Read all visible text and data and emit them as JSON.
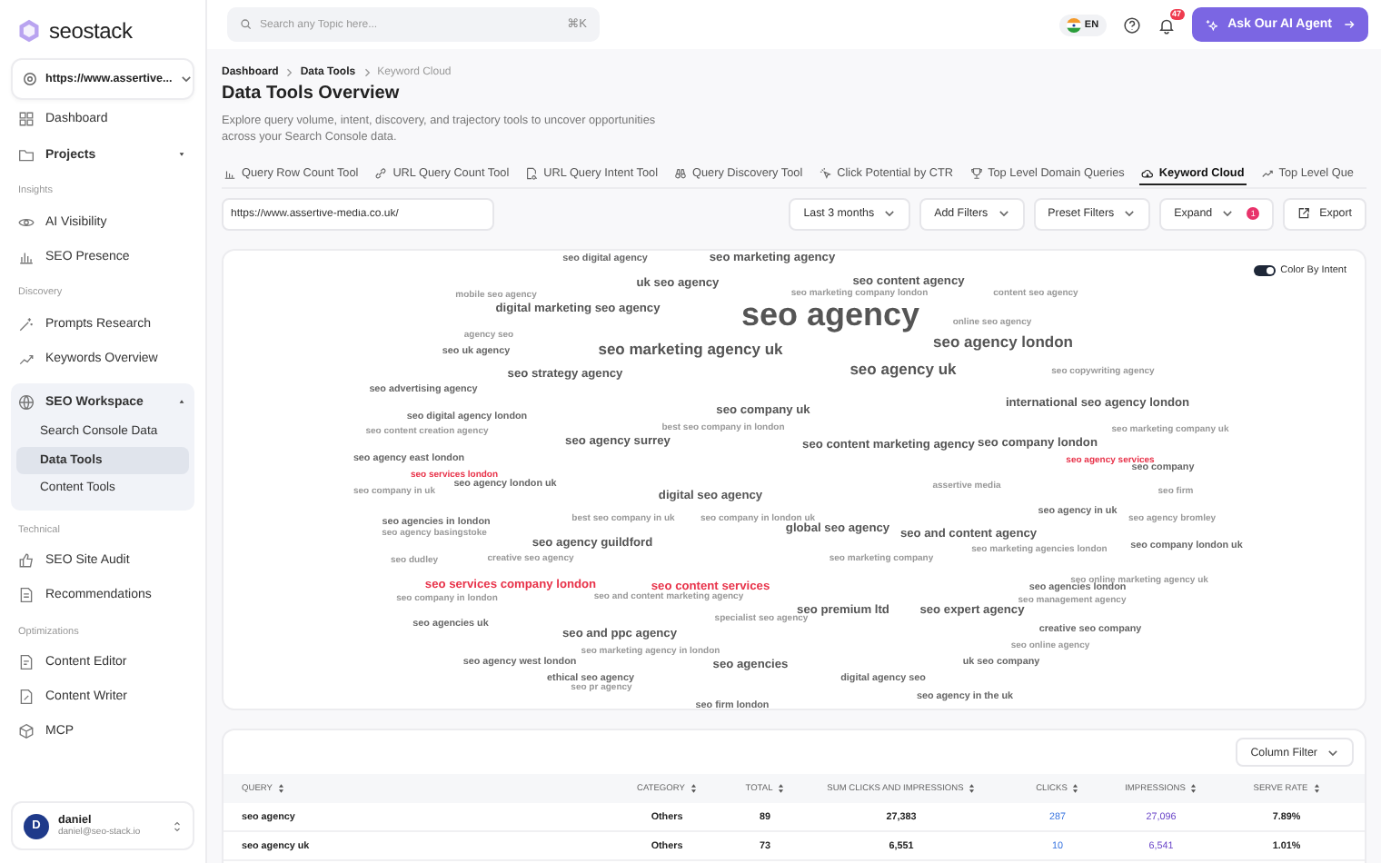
{
  "sidebar": {
    "logo": "**seo**stack",
    "site_selector": "https://www.assertive...",
    "sections": [
      {
        "items": [
          {
            "label": "Dashboard",
            "kind": "link",
            "selected": false
          },
          {
            "label": "Projects",
            "kind": "group",
            "selected": false,
            "expanded": false
          }
        ]
      },
      {
        "heading": "Insights",
        "items": [
          {
            "label": "AI Visibility",
            "kind": "link",
            "selected": false
          },
          {
            "label": "SEO Presence",
            "kind": "link",
            "selected": false
          }
        ]
      },
      {
        "heading": "Discovery",
        "items": [
          {
            "label": "Prompts Research",
            "kind": "link",
            "selected": false
          },
          {
            "label": "Keywords Overview",
            "kind": "link",
            "selected": false
          },
          {
            "label": "SEO Workspace",
            "kind": "group",
            "selected": false,
            "expanded": true,
            "children": [
              {
                "label": "Search Console Data",
                "selected": false
              },
              {
                "label": "Data Tools",
                "selected": true
              },
              {
                "label": "Content Tools",
                "selected": false
              }
            ]
          }
        ]
      },
      {
        "heading": "Technical",
        "items": [
          {
            "label": "SEO Site Audit",
            "kind": "link",
            "selected": false
          },
          {
            "label": "Recommendations",
            "kind": "link",
            "selected": false
          }
        ]
      },
      {
        "heading": "Optimizations",
        "items": [
          {
            "label": "Content Editor",
            "kind": "link",
            "selected": false
          },
          {
            "label": "Content Writer",
            "kind": "link",
            "selected": false
          },
          {
            "label": "MCP",
            "kind": "link",
            "selected": false
          }
        ]
      }
    ],
    "user": {
      "initial": "D",
      "name": "daniel",
      "email": "daniel@seo-stack.io"
    }
  },
  "topbar": {
    "search": {
      "placeholder": "Search any Topic here...",
      "shortcut": "⌘K"
    },
    "language": "EN",
    "notifications": "47",
    "ai_button": "Ask Our AI Agent"
  },
  "breadcrumb": [
    {
      "label": "Dashboard",
      "current": false
    },
    {
      "label": "Data Tools",
      "current": false
    },
    {
      "label": "Keyword Cloud",
      "current": true
    }
  ],
  "title": "Data Tools Overview",
  "description": "Explore query volume, intent, discovery, and trajectory tools to uncover opportunities across your Search Console data.",
  "tabs": [
    {
      "label": "Query Row Count Tool",
      "selected": false
    },
    {
      "label": "URL Query Count Tool",
      "selected": false
    },
    {
      "label": "URL Query Intent Tool",
      "selected": false
    },
    {
      "label": "Query Discovery Tool",
      "selected": false
    },
    {
      "label": "Click Potential by CTR",
      "selected": false
    },
    {
      "label": "Top Level Domain Queries",
      "selected": false
    },
    {
      "label": "Keyword Cloud",
      "selected": true
    },
    {
      "label": "Top Level Que",
      "selected": false
    }
  ],
  "toolbar": {
    "url": "https://www.assertive-media.co.uk/",
    "filters": [
      {
        "label": "Last 3 months"
      },
      {
        "label": "Add Filters"
      },
      {
        "label": "Preset Filters"
      },
      {
        "label": "Expand",
        "badge": "1"
      }
    ],
    "export": "Export"
  },
  "cloud": {
    "toggle": {
      "label": "Color By Intent",
      "on": true
    },
    "words": [
      {
        "text": "seo digital agency",
        "kind": "sm",
        "color": "#666666"
      },
      {
        "text": "seo marketing agency",
        "kind": "md",
        "color": "#555555"
      },
      {
        "text": "uk seo agency",
        "kind": "md",
        "color": "#555555"
      },
      {
        "text": "seo content agency",
        "kind": "md",
        "color": "#555555"
      },
      {
        "text": "mobile seo agency",
        "kind": "xs",
        "color": "#999999"
      },
      {
        "text": "seo marketing company london",
        "kind": "xs",
        "color": "#999999"
      },
      {
        "text": "content seo agency",
        "kind": "xs",
        "color": "#999999"
      },
      {
        "text": "digital marketing seo agency",
        "kind": "md",
        "color": "#555555"
      },
      {
        "text": "seo agency",
        "kind": "xl",
        "color": "#555555"
      },
      {
        "text": "online seo agency",
        "kind": "xs",
        "color": "#999999"
      },
      {
        "text": "agency seo",
        "kind": "xs",
        "color": "#999999"
      },
      {
        "text": "seo uk agency",
        "kind": "sm",
        "color": "#666666"
      },
      {
        "text": "seo marketing agency uk",
        "kind": "lg",
        "color": "#555555"
      },
      {
        "text": "seo agency london",
        "kind": "lg",
        "color": "#555555"
      },
      {
        "text": "seo strategy agency",
        "kind": "md",
        "color": "#555555"
      },
      {
        "text": "seo agency uk",
        "kind": "lg",
        "color": "#555555"
      },
      {
        "text": "seo copywriting agency",
        "kind": "xs",
        "color": "#999999"
      },
      {
        "text": "seo advertising agency",
        "kind": "sm",
        "color": "#666666"
      },
      {
        "text": "seo digital agency london",
        "kind": "sm",
        "color": "#666666"
      },
      {
        "text": "seo company uk",
        "kind": "md",
        "color": "#555555"
      },
      {
        "text": "international seo agency london",
        "kind": "md",
        "color": "#555555"
      },
      {
        "text": "seo content creation agency",
        "kind": "xs",
        "color": "#999999"
      },
      {
        "text": "best seo company in london",
        "kind": "xs",
        "color": "#999999"
      },
      {
        "text": "seo marketing company uk",
        "kind": "xs",
        "color": "#999999"
      },
      {
        "text": "seo agency surrey",
        "kind": "md",
        "color": "#555555"
      },
      {
        "text": "seo content marketing agency",
        "kind": "md",
        "color": "#555555"
      },
      {
        "text": "seo company london",
        "kind": "md",
        "color": "#555555"
      },
      {
        "text": "seo agency east london",
        "kind": "sm",
        "color": "#666666"
      },
      {
        "text": "seo agency services",
        "kind": "xs",
        "color": "#e8334a"
      },
      {
        "text": "seo services london",
        "kind": "xs",
        "color": "#e8334a"
      },
      {
        "text": "seo company",
        "kind": "sm",
        "color": "#666666"
      },
      {
        "text": "seo company in uk",
        "kind": "xs",
        "color": "#999999"
      },
      {
        "text": "seo agency london uk",
        "kind": "sm",
        "color": "#666666"
      },
      {
        "text": "digital seo agency",
        "kind": "md",
        "color": "#555555"
      },
      {
        "text": "assertive media",
        "kind": "xs",
        "color": "#999999"
      },
      {
        "text": "seo firm",
        "kind": "xs",
        "color": "#999999"
      },
      {
        "text": "seo agencies in london",
        "kind": "sm",
        "color": "#666666"
      },
      {
        "text": "best seo company in uk",
        "kind": "xs",
        "color": "#999999"
      },
      {
        "text": "seo company in london uk",
        "kind": "xs",
        "color": "#999999"
      },
      {
        "text": "seo agency in uk",
        "kind": "sm",
        "color": "#666666"
      },
      {
        "text": "seo agency bromley",
        "kind": "xs",
        "color": "#999999"
      },
      {
        "text": "seo agency basingstoke",
        "kind": "xs",
        "color": "#999999"
      },
      {
        "text": "global seo agency",
        "kind": "md",
        "color": "#555555"
      },
      {
        "text": "seo agency guildford",
        "kind": "md",
        "color": "#555555"
      },
      {
        "text": "seo and content agency",
        "kind": "md",
        "color": "#555555"
      },
      {
        "text": "seo marketing agencies london",
        "kind": "xs",
        "color": "#999999"
      },
      {
        "text": "seo company london uk",
        "kind": "sm",
        "color": "#666666"
      },
      {
        "text": "seo dudley",
        "kind": "xs",
        "color": "#999999"
      },
      {
        "text": "creative seo agency",
        "kind": "xs",
        "color": "#999999"
      },
      {
        "text": "seo marketing company",
        "kind": "xs",
        "color": "#999999"
      },
      {
        "text": "seo services company london",
        "kind": "md",
        "color": "#e8334a"
      },
      {
        "text": "seo content services",
        "kind": "md",
        "color": "#e8334a"
      },
      {
        "text": "seo agencies london",
        "kind": "sm",
        "color": "#666666"
      },
      {
        "text": "seo online marketing agency uk",
        "kind": "xs",
        "color": "#999999"
      },
      {
        "text": "seo company in london",
        "kind": "xs",
        "color": "#999999"
      },
      {
        "text": "seo and content marketing agency",
        "kind": "xs",
        "color": "#999999"
      },
      {
        "text": "seo management agency",
        "kind": "xs",
        "color": "#999999"
      },
      {
        "text": "seo agencies uk",
        "kind": "sm",
        "color": "#666666"
      },
      {
        "text": "specialist seo agency",
        "kind": "xs",
        "color": "#999999"
      },
      {
        "text": "seo premium ltd",
        "kind": "md",
        "color": "#555555"
      },
      {
        "text": "seo expert agency",
        "kind": "md",
        "color": "#555555"
      },
      {
        "text": "seo and ppc agency",
        "kind": "md",
        "color": "#555555"
      },
      {
        "text": "creative seo company",
        "kind": "sm",
        "color": "#666666"
      },
      {
        "text": "seo marketing agency in london",
        "kind": "xs",
        "color": "#999999"
      },
      {
        "text": "seo online agency",
        "kind": "xs",
        "color": "#999999"
      },
      {
        "text": "seo agency west london",
        "kind": "sm",
        "color": "#666666"
      },
      {
        "text": "seo agencies",
        "kind": "md",
        "color": "#555555"
      },
      {
        "text": "uk seo company",
        "kind": "sm",
        "color": "#666666"
      },
      {
        "text": "ethical seo agency",
        "kind": "sm",
        "color": "#666666"
      },
      {
        "text": "digital agency seo",
        "kind": "sm",
        "color": "#666666"
      },
      {
        "text": "seo pr agency",
        "kind": "xs",
        "color": "#999999"
      },
      {
        "text": "seo agency in the uk",
        "kind": "sm",
        "color": "#666666"
      },
      {
        "text": "seo firm london",
        "kind": "sm",
        "color": "#666666"
      }
    ]
  },
  "table": {
    "column_filter": "Column Filter",
    "columns": [
      {
        "label": "QUERY",
        "kind": "text"
      },
      {
        "label": "CATEGORY",
        "kind": "category"
      },
      {
        "label": "TOTAL",
        "kind": "number"
      },
      {
        "label": "SUM CLICKS AND IMPRESSIONS",
        "kind": "number"
      },
      {
        "label": "CLICKS",
        "kind": "clicks"
      },
      {
        "label": "IMPRESSIONS",
        "kind": "impressions"
      },
      {
        "label": "SERVE RATE",
        "kind": "number"
      }
    ],
    "rows": [
      {
        "cells": [
          "seo agency",
          "Others",
          "89",
          "27,383",
          "287",
          "27,096",
          "7.89%"
        ]
      },
      {
        "cells": [
          "seo agency uk",
          "Others",
          "73",
          "6,551",
          "10",
          "6,541",
          "1.01%"
        ]
      }
    ]
  }
}
